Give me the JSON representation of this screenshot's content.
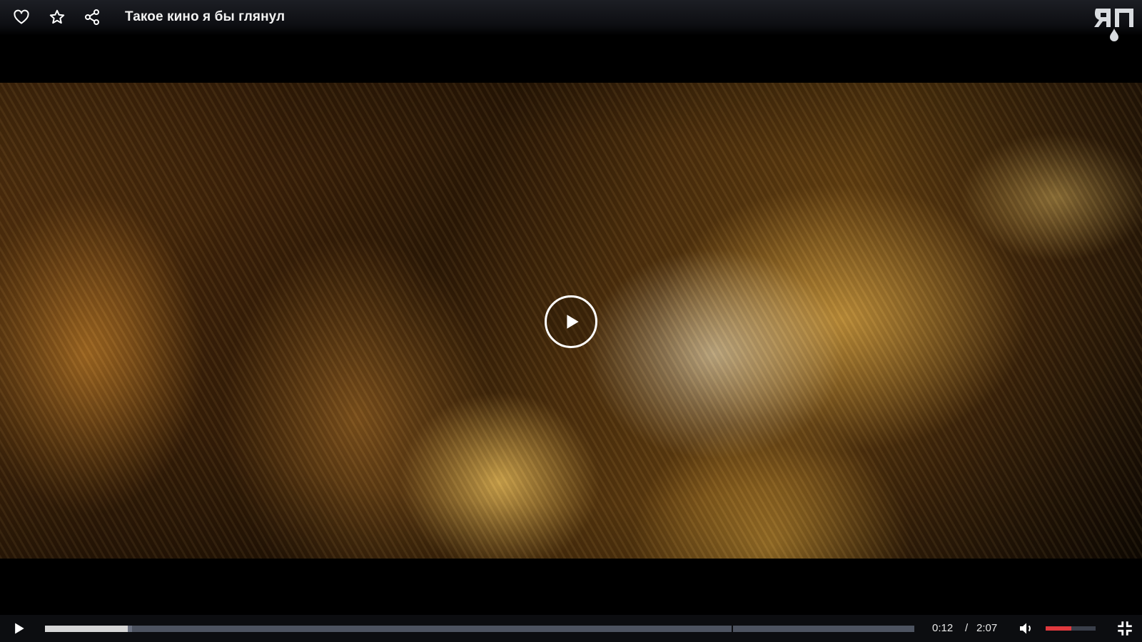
{
  "header": {
    "title": "Такое кино я бы глянул",
    "icons": [
      "heart-icon",
      "star-icon",
      "share-icon"
    ],
    "logo": "yp-logo"
  },
  "video": {
    "state": "paused",
    "center_icon": "play-icon"
  },
  "controls": {
    "current_time": "0:12",
    "separator": "/",
    "duration": "2:07",
    "played_fraction": 0.095,
    "buffered_fraction": 0.1,
    "volume_fraction": 0.52,
    "icons": [
      "play-icon",
      "volume-icon",
      "exit-fullscreen-icon"
    ]
  },
  "colors": {
    "accent": "#e0393e",
    "bar_bg": "#0c0d10",
    "track": "#4d5360",
    "played": "#d6d6d6"
  }
}
